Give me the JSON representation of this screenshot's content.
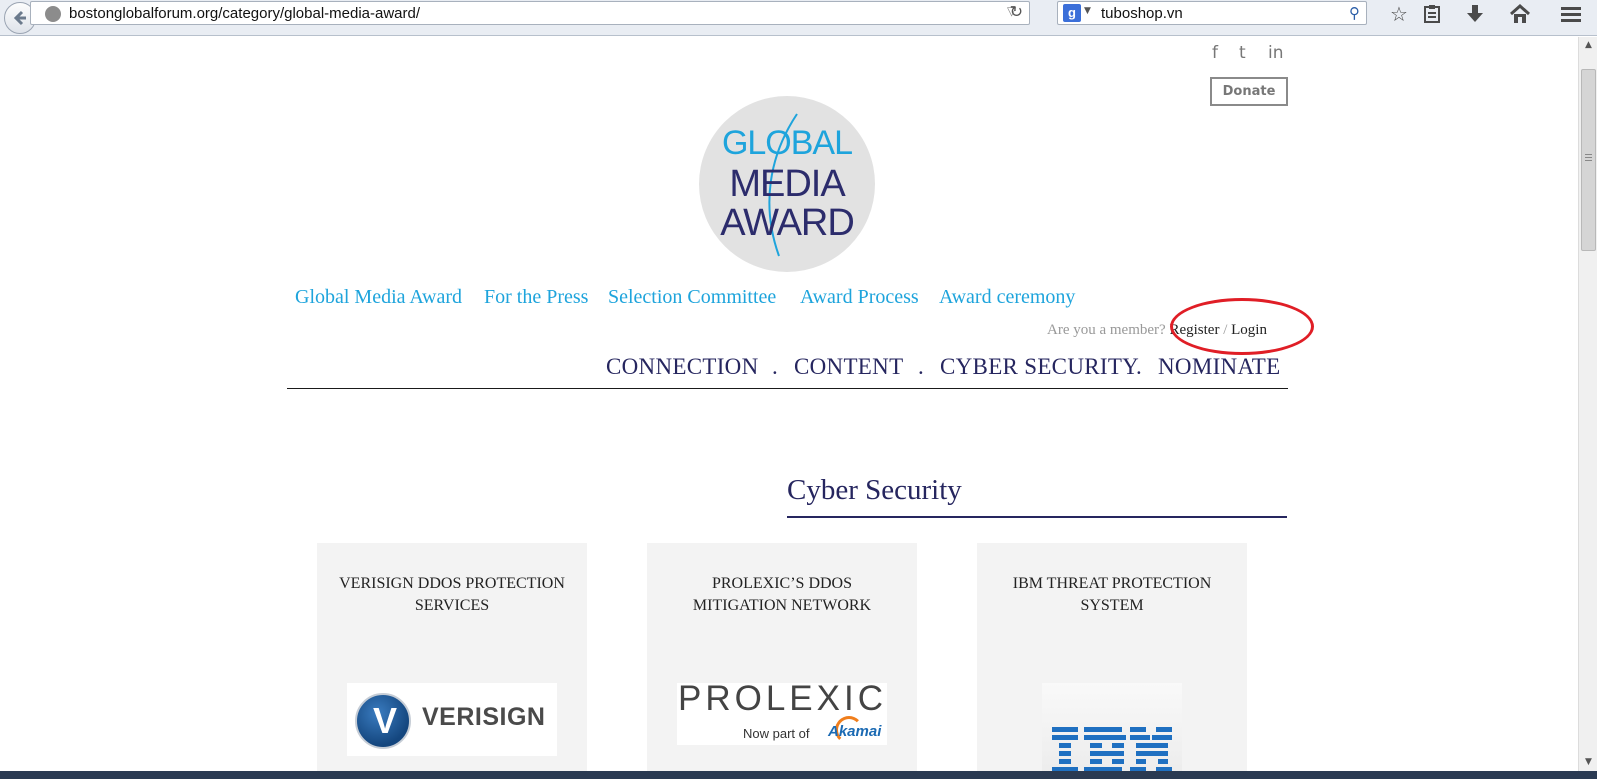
{
  "browser": {
    "url": "bostonglobalforum.org/category/global-media-award/",
    "search_engine_letter": "g",
    "search_query": "tuboshop.vn",
    "toolbar_icons": [
      "bookmark-star-icon",
      "bookmarks-list-icon",
      "downloads-icon",
      "home-icon",
      "menu-icon"
    ]
  },
  "header": {
    "social": [
      "f",
      "t",
      "in"
    ],
    "donate_label": "Donate",
    "logo": {
      "line1": "GLOBAL",
      "line2": "MEDIA",
      "line3": "AWARD"
    }
  },
  "top_nav": [
    {
      "label": "Global Media Award"
    },
    {
      "label": "For the Press"
    },
    {
      "label": "Selection Committee"
    },
    {
      "label": "Award Process"
    },
    {
      "label": "Award ceremony"
    }
  ],
  "member": {
    "prompt": "Are you a member?",
    "register": "Register",
    "separator": "/",
    "login": "Login"
  },
  "main_nav": {
    "items": [
      "CONNECTION",
      "CONTENT",
      "CYBER SECURITY",
      "NOMINATE"
    ],
    "separator": "."
  },
  "section": {
    "title": "Cyber Security"
  },
  "cards": [
    {
      "title": "Verisign DDoS Protection Services",
      "logo_text": "VERISIGN",
      "logo_mark": "V"
    },
    {
      "title": "Prolexic’s DDoS Mitigation Network",
      "logo_text": "PROLEXIC",
      "logo_sub": "Now part of",
      "logo_partner": "Akamai"
    },
    {
      "title": "IBM Threat Protection System",
      "logo_text": "IBM"
    }
  ],
  "colors": {
    "brand_blue": "#1ea4dc",
    "navy": "#26265f",
    "highlight_circle": "#e01e26",
    "card_bg": "#f3f3f3"
  }
}
